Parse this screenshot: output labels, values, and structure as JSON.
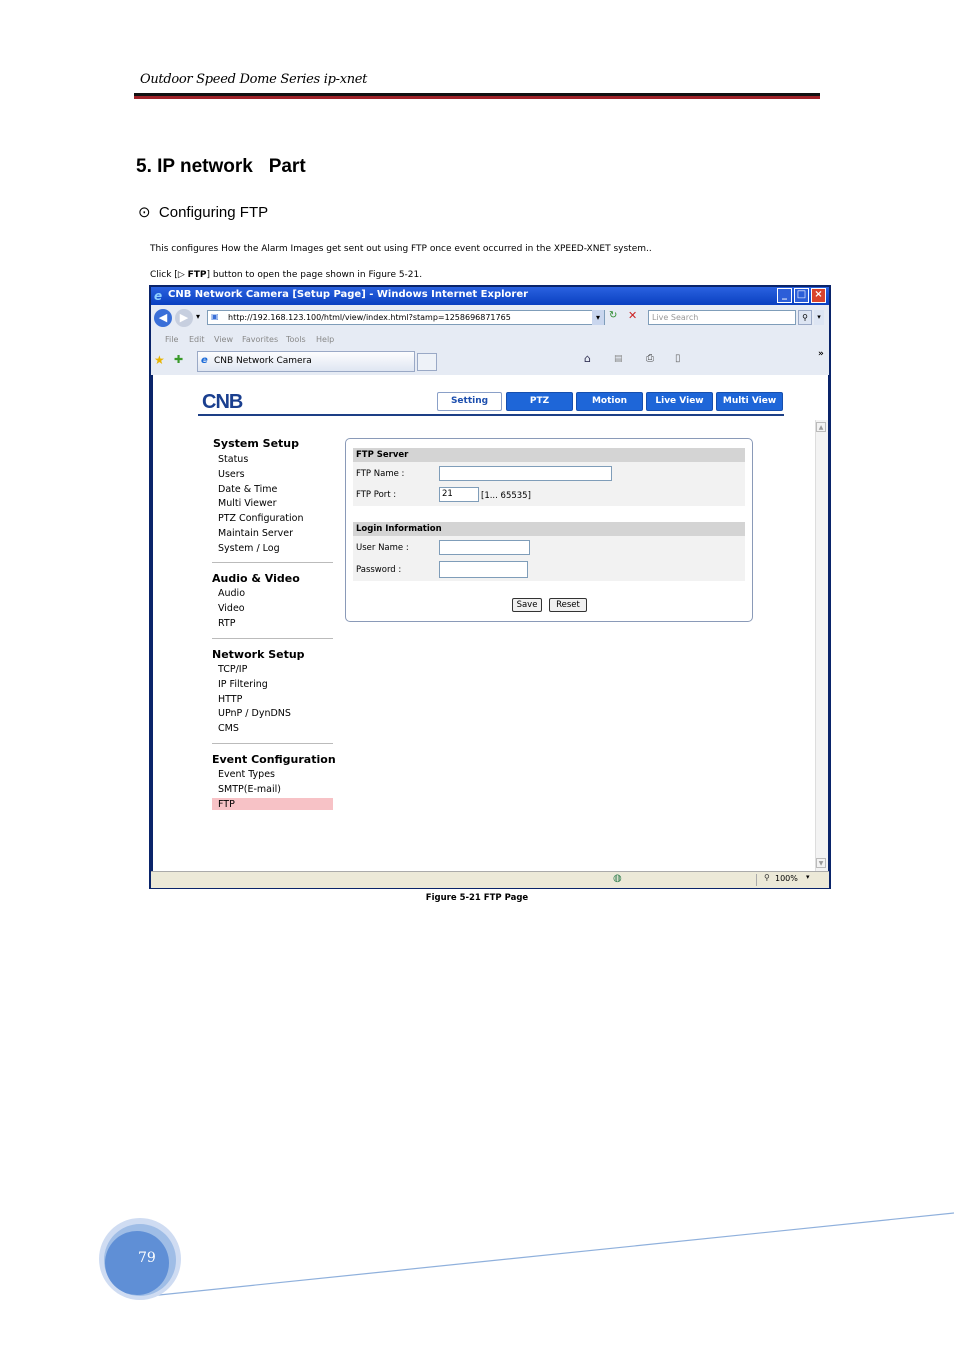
{
  "page_header": {
    "title": "Outdoor Speed Dome Series   ip-xnet"
  },
  "section": {
    "title": "5. IP network   Part",
    "subsection": "⊙  Configuring FTP",
    "paragraph1": "This configures How the Alarm Images get sent out using FTP once event occurred in the XPEED-XNET system..",
    "paragraph2_pre": "Click [▷ ",
    "paragraph2_bold": "FTP",
    "paragraph2_post": "] button to open the page shown in Figure 5-21."
  },
  "browser": {
    "title": "CNB Network Camera [Setup Page] - Windows Internet Explorer",
    "url": "http://192.168.123.100/html/view/index.html?stamp=1258696871765",
    "search_placeholder": "Live Search",
    "menu": [
      "File",
      "Edit",
      "View",
      "Favorites",
      "Tools",
      "Help"
    ],
    "tab_label": "CNB Network Camera",
    "zoom": "100%"
  },
  "camera_page": {
    "logo": "CNB",
    "top_nav": [
      "Setting",
      "PTZ",
      "Motion",
      "Live View",
      "Multi View"
    ],
    "sidebar": {
      "groups": [
        {
          "title": "System Setup",
          "items": [
            "Status",
            "Users",
            "Date & Time",
            "Multi Viewer",
            "PTZ Configuration",
            "Maintain Server",
            "System / Log"
          ]
        },
        {
          "title": "Audio & Video",
          "items": [
            "Audio",
            "Video",
            "RTP"
          ]
        },
        {
          "title": "Network Setup",
          "items": [
            "TCP/IP",
            "IP Filtering",
            "HTTP",
            "UPnP / DynDNS",
            "CMS"
          ]
        },
        {
          "title": "Event Configuration",
          "items": [
            "Event Types",
            "SMTP(E-mail)",
            "FTP"
          ]
        }
      ]
    },
    "form": {
      "ftp_server_header": "FTP Server",
      "ftp_name_label": "FTP Name :",
      "ftp_name_value": "",
      "ftp_port_label": "FTP Port :",
      "ftp_port_value": "21",
      "ftp_port_range": "[1... 65535]",
      "login_header": "Login Information",
      "user_name_label": "User Name :",
      "user_name_value": "",
      "password_label": "Password :",
      "password_value": "",
      "save_label": "Save",
      "reset_label": "Reset"
    }
  },
  "figure_caption": "Figure 5-21 FTP Page",
  "page_number": "79"
}
